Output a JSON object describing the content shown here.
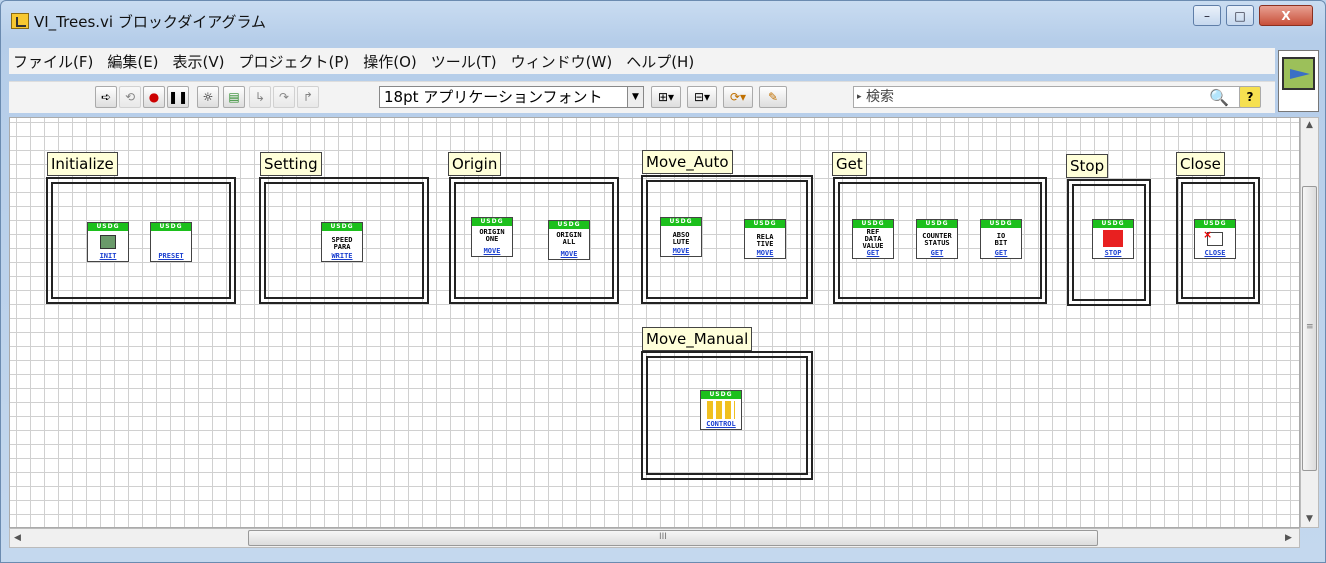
{
  "window": {
    "title": "VI_Trees.vi ブロックダイアグラム",
    "min": "–",
    "max": "□",
    "close": "X"
  },
  "menu": [
    "ファイル(F)",
    "編集(E)",
    "表示(V)",
    "プロジェクト(P)",
    "操作(O)",
    "ツール(T)",
    "ウィンドウ(W)",
    "ヘルプ(H)"
  ],
  "toolbar": {
    "font": "18pt アプリケーションフォント",
    "search_placeholder": "検索",
    "help": "?"
  },
  "scroll": {
    "hthumb": "III",
    "vthumb": "≡"
  },
  "header_text": "USDG",
  "cases": [
    {
      "label": "Initialize",
      "nodes": [
        {
          "txt": "",
          "ftr": "INIT"
        },
        {
          "txt": "",
          "ftr": "PRESET"
        }
      ]
    },
    {
      "label": "Setting",
      "nodes": [
        {
          "txt": "SPEED\nPARA",
          "ftr": "WRITE"
        }
      ]
    },
    {
      "label": "Origin",
      "nodes": [
        {
          "txt": "ORIGIN\nONE",
          "ftr": "MOVE"
        },
        {
          "txt": "ORIGIN\nALL",
          "ftr": "MOVE"
        }
      ]
    },
    {
      "label": "Move_Auto",
      "nodes": [
        {
          "txt": "ABSO\nLUTE",
          "ftr": "MOVE"
        },
        {
          "txt": "RELA\nTIVE",
          "ftr": "MOVE"
        }
      ]
    },
    {
      "label": "Get",
      "nodes": [
        {
          "txt": "REF\nDATA\nVALUE",
          "ftr": "GET"
        },
        {
          "txt": "COUNTER\nSTATUS",
          "ftr": "GET"
        },
        {
          "txt": "IO\nBIT",
          "ftr": "GET"
        }
      ]
    },
    {
      "label": "Stop",
      "nodes": [
        {
          "txt": "",
          "ftr": "STOP"
        }
      ]
    },
    {
      "label": "Close",
      "nodes": [
        {
          "txt": "",
          "ftr": "CLOSE"
        }
      ]
    },
    {
      "label": "Move_Manual",
      "nodes": [
        {
          "txt": "",
          "ftr": "CONTROL"
        }
      ]
    }
  ],
  "colors": {
    "node_header": "#1cc01c",
    "node_footer": "#1a3fd0",
    "case_label_bg": "#ffffd9",
    "stop_red": "#e82020"
  }
}
